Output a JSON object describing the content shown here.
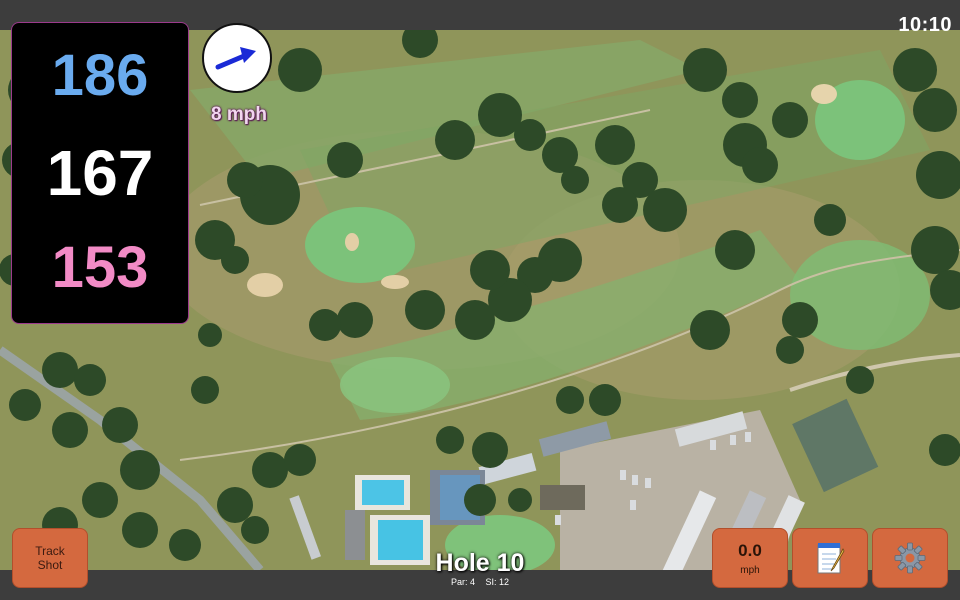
{
  "status": {
    "time": "10:10"
  },
  "distances": {
    "back": "186",
    "center": "167",
    "front": "153"
  },
  "wind": {
    "speed": "8 mph",
    "icon": "arrow-icon"
  },
  "buttons": {
    "track_shot_line1": "Track",
    "track_shot_line2": "Shot",
    "speed_value": "0.0",
    "speed_unit": "mph",
    "notes_icon": "notepad-icon",
    "settings_icon": "gear-icon"
  },
  "hole": {
    "title": "Hole 10",
    "par": "Par: 4",
    "si": "SI: 12"
  },
  "colors": {
    "back_distance": "#6aabef",
    "center_distance": "#ffffff",
    "front_distance": "#f28bc6",
    "button": "#d4693f",
    "panel_border": "#9b3a8c"
  }
}
